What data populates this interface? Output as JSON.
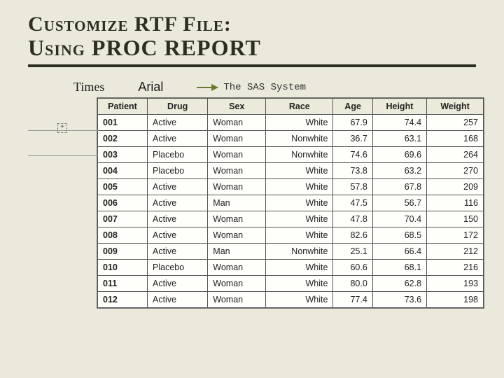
{
  "title": {
    "line1": "Customize RTF File:",
    "line2": "Using PROC REPORT"
  },
  "labels": {
    "times": "Times",
    "arial": "Arial",
    "sas": "The SAS System",
    "marker": "+"
  },
  "columns": [
    "Patient",
    "Drug",
    "Sex",
    "Race",
    "Age",
    "Height",
    "Weight"
  ],
  "rows": [
    {
      "patient": "001",
      "drug": "Active",
      "sex": "Woman",
      "race": "White",
      "age": "67.9",
      "height": "74.4",
      "weight": "257"
    },
    {
      "patient": "002",
      "drug": "Active",
      "sex": "Woman",
      "race": "Nonwhite",
      "age": "36.7",
      "height": "63.1",
      "weight": "168"
    },
    {
      "patient": "003",
      "drug": "Placebo",
      "sex": "Woman",
      "race": "Nonwhite",
      "age": "74.6",
      "height": "69.6",
      "weight": "264"
    },
    {
      "patient": "004",
      "drug": "Placebo",
      "sex": "Woman",
      "race": "White",
      "age": "73.8",
      "height": "63.2",
      "weight": "270"
    },
    {
      "patient": "005",
      "drug": "Active",
      "sex": "Woman",
      "race": "White",
      "age": "57.8",
      "height": "67.8",
      "weight": "209"
    },
    {
      "patient": "006",
      "drug": "Active",
      "sex": "Man",
      "race": "White",
      "age": "47.5",
      "height": "56.7",
      "weight": "116"
    },
    {
      "patient": "007",
      "drug": "Active",
      "sex": "Woman",
      "race": "White",
      "age": "47.8",
      "height": "70.4",
      "weight": "150"
    },
    {
      "patient": "008",
      "drug": "Active",
      "sex": "Woman",
      "race": "White",
      "age": "82.6",
      "height": "68.5",
      "weight": "172"
    },
    {
      "patient": "009",
      "drug": "Active",
      "sex": "Man",
      "race": "Nonwhite",
      "age": "25.1",
      "height": "66.4",
      "weight": "212"
    },
    {
      "patient": "010",
      "drug": "Placebo",
      "sex": "Woman",
      "race": "White",
      "age": "60.6",
      "height": "68.1",
      "weight": "216"
    },
    {
      "patient": "011",
      "drug": "Active",
      "sex": "Woman",
      "race": "White",
      "age": "80.0",
      "height": "62.8",
      "weight": "193"
    },
    {
      "patient": "012",
      "drug": "Active",
      "sex": "Woman",
      "race": "White",
      "age": "77.4",
      "height": "73.6",
      "weight": "198"
    }
  ]
}
